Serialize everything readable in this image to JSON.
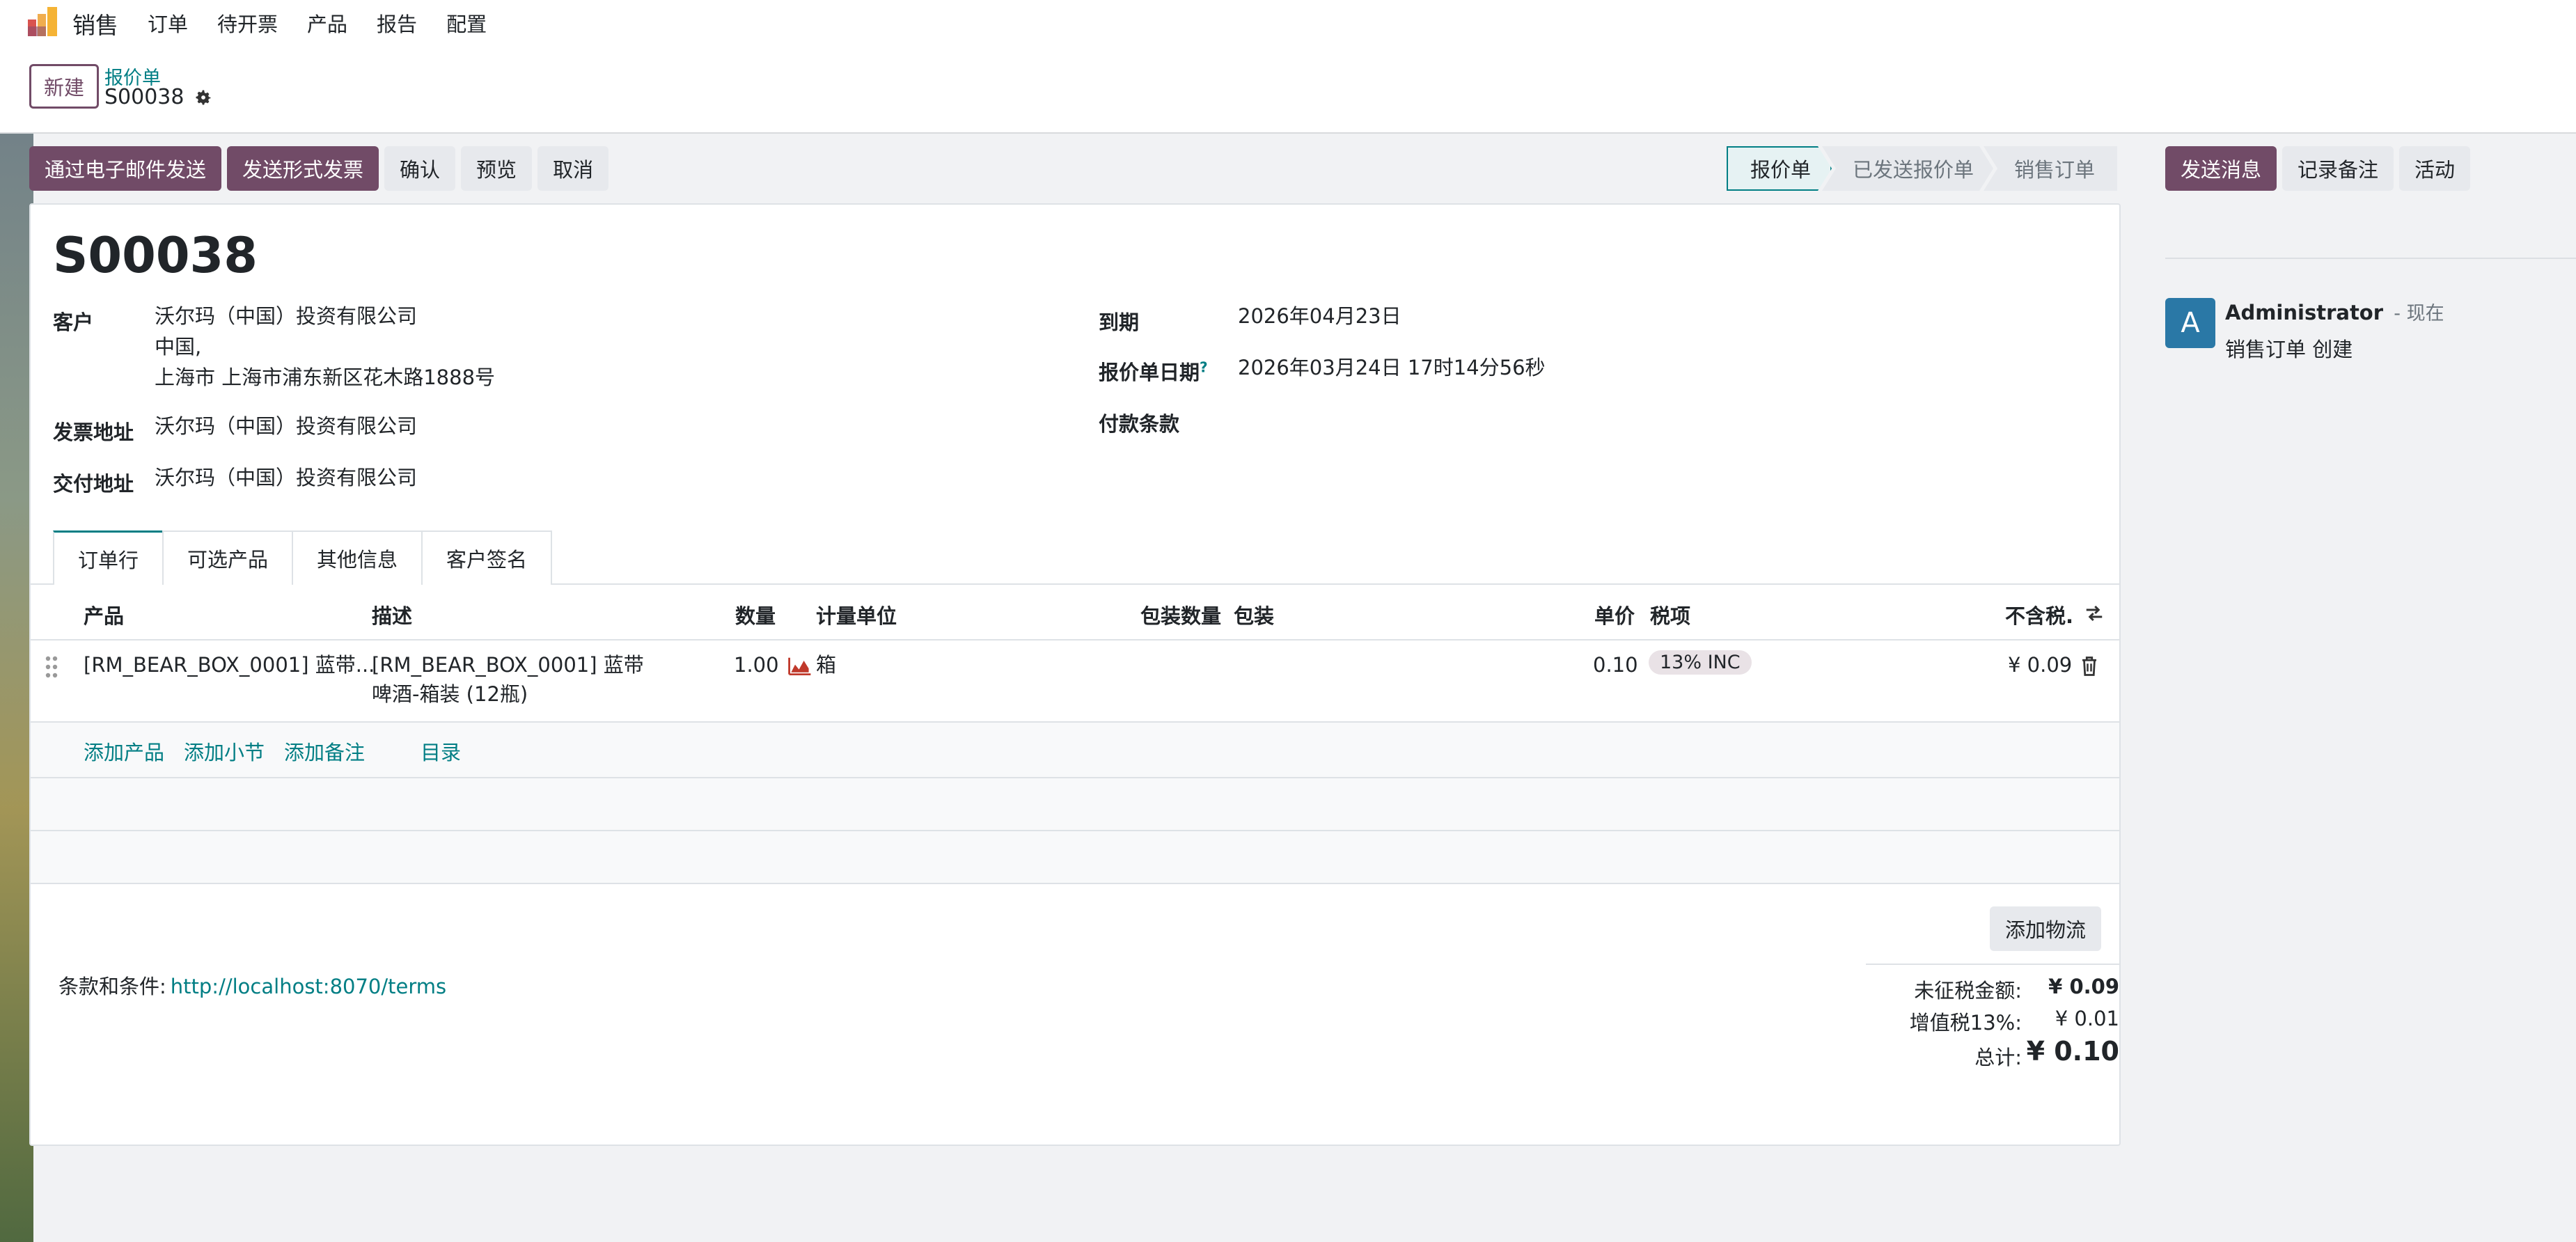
{
  "app": {
    "name": "销售",
    "menu": [
      "订单",
      "待开票",
      "产品",
      "报告",
      "配置"
    ]
  },
  "control_panel": {
    "new_button": "新建",
    "breadcrumb_parent": "报价单",
    "breadcrumb_current": "S00038"
  },
  "actions": {
    "send_email": "通过电子邮件发送",
    "send_proforma": "发送形式发票",
    "confirm": "确认",
    "preview": "预览",
    "cancel": "取消"
  },
  "status_stages": [
    {
      "label": "报价单",
      "active": true
    },
    {
      "label": "已发送报价单",
      "active": false
    },
    {
      "label": "销售订单",
      "active": false
    }
  ],
  "chatter": {
    "send_message": "发送消息",
    "log_note": "记录备注",
    "activity": "活动",
    "message": {
      "avatar_letter": "A",
      "author": "Administrator",
      "time": "- 现在",
      "body": "销售订单 创建"
    }
  },
  "form": {
    "order_name": "S00038",
    "customer_label": "客户",
    "customer_name": "沃尔玛（中国）投资有限公司",
    "customer_country": "中国,",
    "customer_address": "上海市 上海市浦东新区花木路1888号",
    "invoice_address_label": "发票地址",
    "invoice_address": "沃尔玛（中国）投资有限公司",
    "delivery_address_label": "交付地址",
    "delivery_address": "沃尔玛（中国）投资有限公司",
    "expiration_label": "到期",
    "expiration": "2026年04月23日",
    "quotation_date_label": "报价单日期",
    "quotation_date_help": "?",
    "quotation_date": "2026年03月24日 17时14分56秒",
    "payment_terms_label": "付款条款"
  },
  "tabs": [
    "订单行",
    "可选产品",
    "其他信息",
    "客户签名"
  ],
  "order_lines": {
    "columns": [
      "产品",
      "描述",
      "数量",
      "计量单位",
      "包装数量",
      "包装",
      "单价",
      "税项",
      "不含税."
    ],
    "rows": [
      {
        "product": "[RM_BEAR_BOX_0001] 蓝带...",
        "description_line1": "[RM_BEAR_BOX_0001] 蓝带",
        "description_line2": "啤酒-箱装 (12瓶)",
        "quantity": "1.00",
        "uom": "箱",
        "unit_price": "0.10",
        "tax": "13% INC",
        "subtotal": "¥ 0.09"
      }
    ],
    "add_product": "添加产品",
    "add_section": "添加小节",
    "add_note": "添加备注",
    "catalog": "目录"
  },
  "footer": {
    "add_shipping": "添加物流",
    "terms_label": "条款和条件:",
    "terms_link": "http://localhost:8070/terms",
    "untaxed_label": "未征税金额:",
    "untaxed_value": "¥ 0.09",
    "vat_label": "增值税13%:",
    "vat_value": "¥ 0.01",
    "total_label": "总计:",
    "total_value": "¥ 0.10"
  },
  "colors": {
    "primary": "#714b67",
    "link": "#017e84",
    "avatar": "#2a78a6"
  }
}
